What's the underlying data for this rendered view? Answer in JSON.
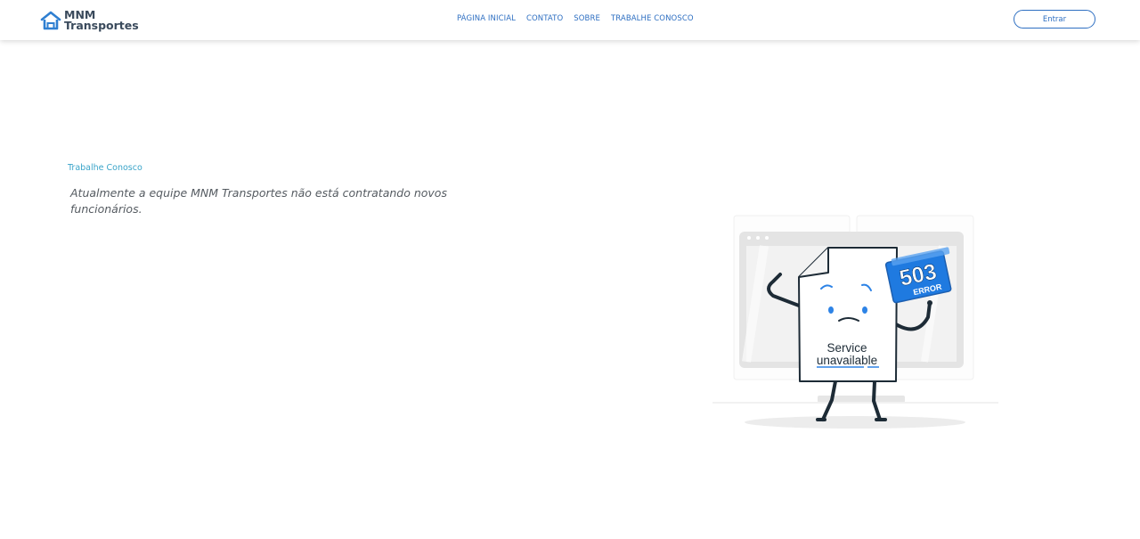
{
  "header": {
    "brand": {
      "line1": "MNM",
      "line2": "Transportes"
    },
    "nav": [
      {
        "label": "PÁGINA INICIAL"
      },
      {
        "label": "CONTATO"
      },
      {
        "label": "SOBRE"
      },
      {
        "label": "TRABALHE CONOSCO"
      }
    ],
    "login_label": "Entrar"
  },
  "main": {
    "section_label": "Trabalhe Conosco",
    "message": "Atualmente a equipe MNM Transportes não está contratando novos funcionários."
  },
  "illustration": {
    "error_code": "503",
    "error_word": "ERROR",
    "caption_line1": "Service",
    "caption_line2": "unavailable"
  },
  "colors": {
    "accent": "#2e6fc2",
    "section_label": "#3aa4c9",
    "logo_blue": "#2f7fd1",
    "sign_blue": "#1f7ae0"
  }
}
